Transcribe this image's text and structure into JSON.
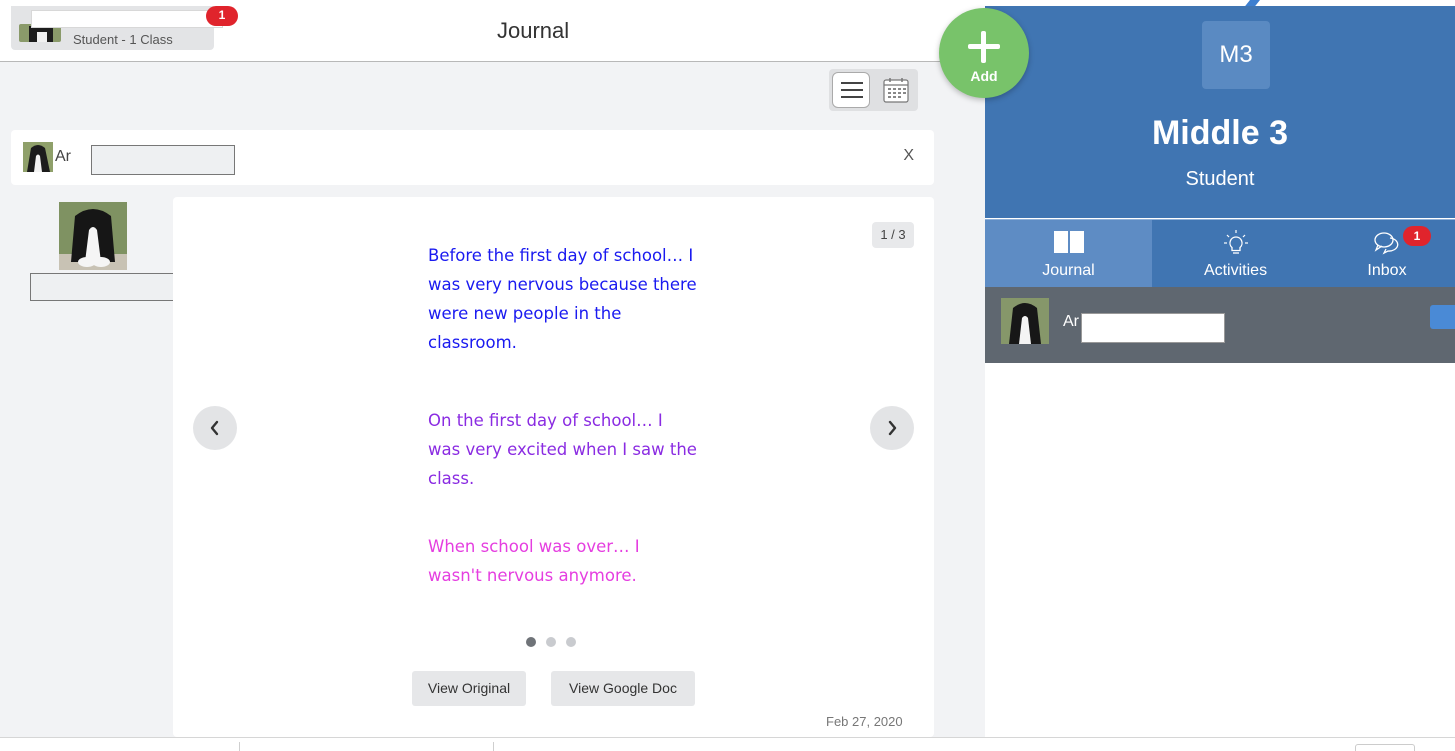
{
  "header": {
    "title": "Journal",
    "student_pill": {
      "subtitle": "Student - 1 Class",
      "badge": "1"
    }
  },
  "author": {
    "name_prefix": "Ar",
    "close_label": "X"
  },
  "entry": {
    "page_indicator": "1 / 3",
    "paragraphs": [
      {
        "text": "Before the first day of school…  I was very nervous because there were new people in the classroom.",
        "color": "#1a1af0"
      },
      {
        "text": "On the first day of school… I was very excited when I saw the class.",
        "color": "#8a2be2"
      },
      {
        "text": "When school was over…  I wasn't nervous anymore.",
        "color": "#e53ee0"
      }
    ],
    "current_page": 1,
    "total_pages": 3,
    "buttons": {
      "view_original": "View Original",
      "view_google_doc": "View Google Doc"
    },
    "date": "Feb 27, 2020"
  },
  "fab": {
    "label": "Add",
    "color": "#78c36a"
  },
  "class_panel": {
    "tile": "M3",
    "name": "Middle 3",
    "role": "Student",
    "accent": "#4075b2",
    "tabs": [
      {
        "label": "Journal",
        "icon": "book-icon",
        "active": true
      },
      {
        "label": "Activities",
        "icon": "lightbulb-icon"
      },
      {
        "label": "Inbox",
        "icon": "chat-bubbles-icon",
        "badge": "1"
      }
    ],
    "student_row": {
      "name_prefix": "Ar"
    }
  },
  "icons": {
    "list_view": "list-view-icon",
    "calendar_view": "calendar-view-icon",
    "prev": "chevron-left-icon",
    "next": "chevron-right-icon",
    "folder": "folder-icon"
  }
}
